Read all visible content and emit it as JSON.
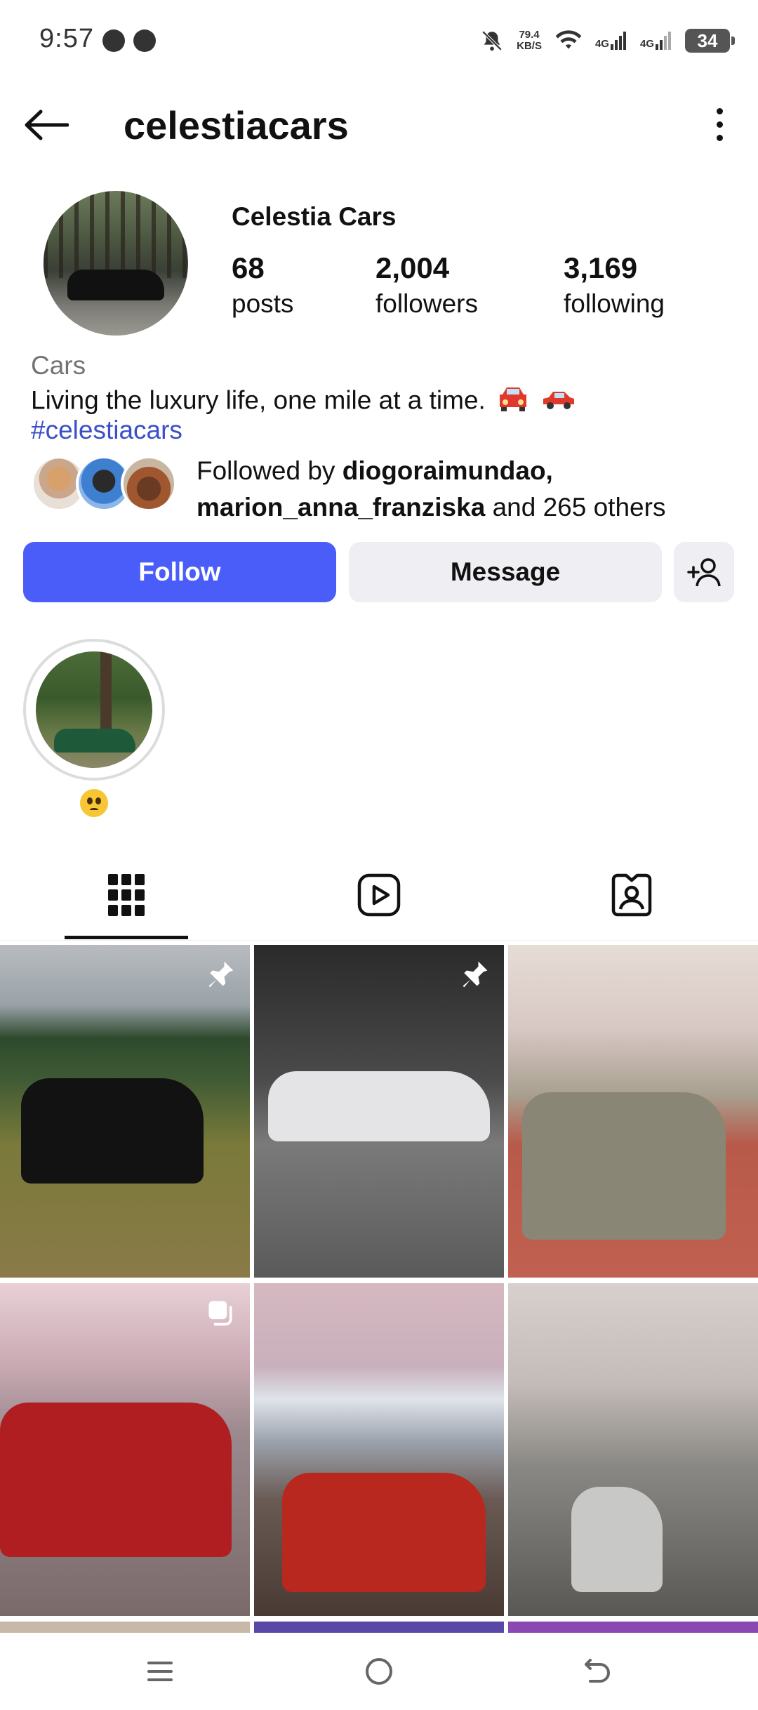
{
  "status_bar": {
    "time": "9:57",
    "net_speed": "79.4",
    "net_unit": "KB/S",
    "network_1": "4G",
    "network_2": "4G",
    "battery": "34"
  },
  "header": {
    "username": "celestiacars"
  },
  "profile": {
    "display_name": "Celestia Cars",
    "stats": [
      {
        "count": "68",
        "label": "posts"
      },
      {
        "count": "2,004",
        "label": "followers"
      },
      {
        "count": "3,169",
        "label": "following"
      }
    ],
    "category": "Cars",
    "bio": "Living the luxury life, one mile at a time.",
    "hashtag": "#celestiacars",
    "followed_by": {
      "prefix": "Followed by",
      "user_1": "diogoraimundao,",
      "user_2": "marion_anna_franziska",
      "suffix": "and 265 others"
    }
  },
  "actions": {
    "follow_label": "Follow",
    "message_label": "Message"
  },
  "highlights": [
    {
      "title_emoji": "pleading-face"
    }
  ],
  "tabs": [
    "grid-icon",
    "reels-icon",
    "tagged-icon"
  ],
  "grid_posts": [
    {
      "badge": "pin-icon",
      "subject": "black Cadillac SUV in field"
    },
    {
      "badge": "pin-icon",
      "subject": "white Porsche in studio"
    },
    {
      "badge": "",
      "subject": "Porsche GT3 RS among cherry blossoms"
    },
    {
      "badge": "carousel-icon",
      "subject": "red Porsche GT2 RS under blossoms"
    },
    {
      "badge": "",
      "subject": "red Porsche with Mount Fuji"
    },
    {
      "badge": "",
      "subject": "silver Porsche on blossom street"
    }
  ],
  "colors": {
    "accent": "#4a5df9",
    "link": "#3a4fc8",
    "secondary_button": "#efeff3"
  }
}
